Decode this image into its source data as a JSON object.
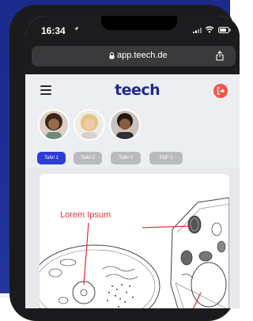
{
  "status_bar": {
    "time": "16:34"
  },
  "browser": {
    "url": "app.teech.de"
  },
  "app": {
    "logo_text": "teech",
    "avatars": [
      "avatar-1",
      "avatar-2",
      "avatar-3"
    ],
    "tabs": [
      "Tafel 1",
      "Tafel 2",
      "Tafel 3",
      "PDF 1"
    ],
    "active_tab": "Tafel 1"
  },
  "content": {
    "annotation_label": "Lorem Ipsum"
  },
  "colors": {
    "background_blue": "#1d2f95",
    "logo_blue": "#1e2a90",
    "active_tab": "#2e3dd6",
    "logout_red": "#f0574b",
    "annotation_red": "#e0383a"
  }
}
